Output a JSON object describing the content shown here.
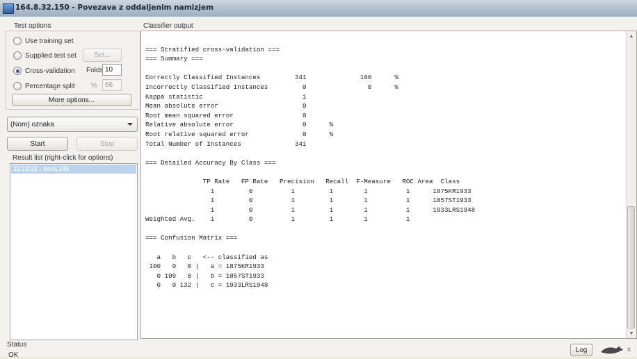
{
  "window": {
    "title": "164.8.32.150 - Povezava z oddaljenim namizjem"
  },
  "test_options": {
    "header": "Test options",
    "use_training_set": "Use training set",
    "supplied_test_set": "Supplied test set",
    "set_button": "Set...",
    "cross_validation": "Cross-validation",
    "folds_label": "Folds",
    "folds_value": "10",
    "percentage_split": "Percentage split",
    "percent_symbol": "%",
    "percentage_value": "66",
    "more_options": "More options...",
    "selected_option": "Cross-validation"
  },
  "class_selector": {
    "value": "(Nom) oznaka"
  },
  "controls": {
    "start": "Start",
    "stop": "Stop"
  },
  "result_list": {
    "header": "Result list (right-click for options)",
    "items": [
      "22:18:32 - trees.J48"
    ]
  },
  "classifier_output": {
    "header": "Classifier output",
    "lines": [
      "",
      "=== Stratified cross-validation ===",
      "=== Summary ===",
      "",
      "Correctly Classified Instances         341              100      %",
      "Incorrectly Classified Instances         0                0      %",
      "Kappa statistic                          1",
      "Mean absolute error                      0",
      "Root mean squared error                  0",
      "Relative absolute error                  0      %",
      "Root relative squared error              0      %",
      "Total Number of Instances              341",
      "",
      "=== Detailed Accuracy By Class ===",
      "",
      "               TP Rate   FP Rate   Precision   Recall  F-Measure   ROC Area  Class",
      "                 1         0          1         1        1          1      1875KR1933",
      "                 1         0          1         1        1          1      1857ST1933",
      "                 1         0          1         1        1          1      1933LRS1948",
      "Weighted Avg.    1         0          1         1        1          1",
      "",
      "=== Confusion Matrix ===",
      "",
      "   a   b   c   <-- classified as",
      " 100   0   0 |   a = 1875KR1933",
      "   0 109   0 |   b = 1857ST1933",
      "   0   0 132 |   c = 1933LRS1948"
    ]
  },
  "status": {
    "header": "Status",
    "text": "OK",
    "log_button": "Log",
    "close_glyph": "x"
  },
  "colors": {
    "selection": "#bcd3ee",
    "radio_selected": "#2a5db0"
  }
}
